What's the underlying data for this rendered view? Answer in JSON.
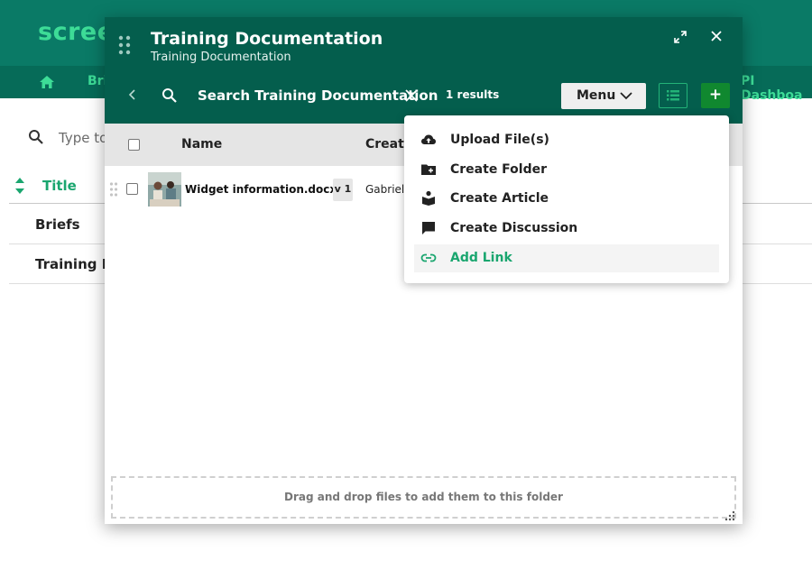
{
  "background": {
    "logo": "scree",
    "nav_items": [
      "Bri",
      "PI Dashboa"
    ],
    "search_placeholder": "Type to",
    "title_column": "Title",
    "rows": [
      "Briefs",
      "Training Do"
    ]
  },
  "modal": {
    "title": "Training Documentation",
    "subtitle": "Training Documentation",
    "search_text": "Search Training Documentation",
    "results": "1 results",
    "menu_label": "Menu",
    "add_label": "+",
    "table": {
      "columns": [
        "Name",
        "Create"
      ],
      "rows": [
        {
          "file_name": "Widget information.docx",
          "version": "v 1",
          "creator": "Gabriel"
        }
      ]
    },
    "dropzone_text": "Drag and drop files to add them to this folder"
  },
  "dropdown": {
    "items": [
      {
        "label": "Upload File(s)",
        "icon": "cloud-upload-icon"
      },
      {
        "label": "Create Folder",
        "icon": "folder-plus-icon"
      },
      {
        "label": "Create Article",
        "icon": "book-reader-icon"
      },
      {
        "label": "Create Discussion",
        "icon": "chat-bubble-icon"
      },
      {
        "label": "Add Link",
        "icon": "link-icon",
        "active": true
      }
    ]
  },
  "colors": {
    "header_bg": "#0a7a66",
    "modal_header_bg": "#045e4d",
    "accent_green": "#1aa66f",
    "add_button_bg": "#10882f"
  }
}
